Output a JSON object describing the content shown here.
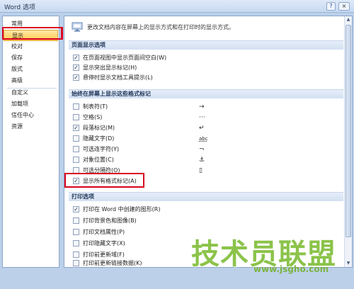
{
  "window": {
    "title": "Word 选项",
    "help_label": "?",
    "close_label": "×"
  },
  "sidebar": {
    "items": [
      {
        "label": "常用"
      },
      {
        "label": "显示"
      },
      {
        "label": "校对"
      },
      {
        "label": "保存"
      },
      {
        "label": "版式"
      },
      {
        "label": "高级"
      },
      {
        "label": "自定义"
      },
      {
        "label": "加载项"
      },
      {
        "label": "信任中心"
      },
      {
        "label": "资源"
      }
    ],
    "selected": "显示"
  },
  "header": {
    "text": "更改文档内容在屏幕上的显示方式和在打印时的显示方式。"
  },
  "sections": {
    "page_display": {
      "title": "页面显示选项",
      "options": [
        {
          "label": "在页面视图中显示页面间空白(W)",
          "checked": true
        },
        {
          "label": "显示突出显示标记(H)",
          "checked": true
        },
        {
          "label": "悬停时显示文档工具提示(L)",
          "checked": true
        }
      ]
    },
    "format_marks": {
      "title": "始终在屏幕上显示这些格式标记",
      "options": [
        {
          "label": "制表符(T)",
          "checked": false,
          "mark": "→"
        },
        {
          "label": "空格(S)",
          "checked": false,
          "mark": "···"
        },
        {
          "label": "段落标记(M)",
          "checked": true,
          "mark": "↵"
        },
        {
          "label": "隐藏文字(D)",
          "checked": false,
          "mark": "abc"
        },
        {
          "label": "可选连字符(Y)",
          "checked": false,
          "mark": "¬"
        },
        {
          "label": "对象位置(C)",
          "checked": false,
          "mark": "⚓"
        },
        {
          "label": "可选分隔符(O)",
          "checked": false,
          "mark": "▯"
        },
        {
          "label": "显示所有格式标记(A)",
          "checked": true,
          "mark": ""
        }
      ]
    },
    "print": {
      "title": "打印选项",
      "options": [
        {
          "label": "打印在 Word 中创建的图形(R)",
          "checked": true
        },
        {
          "label": "打印背景色和图像(B)",
          "checked": false
        },
        {
          "label": "打印文档属性(P)",
          "checked": false
        },
        {
          "label": "打印隐藏文字(X)",
          "checked": false
        },
        {
          "label": "打印前更新域(F)",
          "checked": false
        },
        {
          "label": "打印前更新链接数据(K)",
          "checked": false
        }
      ]
    }
  },
  "watermark": {
    "text": "技术员联盟",
    "url": "www.jsgho.com"
  },
  "colors": {
    "selected_nav": "#ffc94d",
    "highlight_box": "#d8001f",
    "section_header": "#d3e0f2",
    "watermark": "#8bc34a"
  }
}
